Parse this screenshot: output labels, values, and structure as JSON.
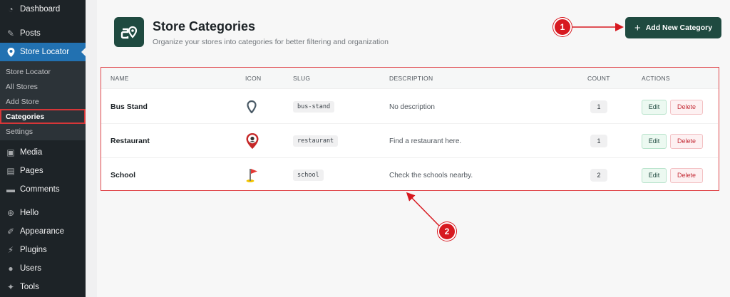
{
  "sidebar": {
    "top_items": [
      {
        "label": "Dashboard",
        "icon": "dashboard-icon"
      },
      {
        "label": "Posts",
        "icon": "pin-icon"
      },
      {
        "label": "Store Locator",
        "icon": "location-icon"
      }
    ],
    "submenu": [
      "Store Locator",
      "All Stores",
      "Add Store",
      "Categories",
      "Settings"
    ],
    "bottom_items": [
      {
        "label": "Media",
        "icon": "media-icon"
      },
      {
        "label": "Pages",
        "icon": "pages-icon"
      },
      {
        "label": "Comments",
        "icon": "comments-icon"
      },
      {
        "label": "Hello",
        "icon": "plus-circle-icon"
      },
      {
        "label": "Appearance",
        "icon": "brush-icon"
      },
      {
        "label": "Plugins",
        "icon": "plug-icon"
      },
      {
        "label": "Users",
        "icon": "user-icon"
      },
      {
        "label": "Tools",
        "icon": "wrench-icon"
      }
    ]
  },
  "header": {
    "title": "Store Categories",
    "subtitle": "Organize your stores into categories for better filtering and organization",
    "add_button": "Add New Category"
  },
  "table": {
    "columns": [
      "NAME",
      "ICON",
      "SLUG",
      "DESCRIPTION",
      "COUNT",
      "ACTIONS"
    ],
    "rows": [
      {
        "name": "Bus Stand",
        "icon": "map-pin-icon",
        "slug": "bus-stand",
        "description": "No description",
        "count": "1",
        "edit": "Edit",
        "delete": "Delete"
      },
      {
        "name": "Restaurant",
        "icon": "chef-pin-icon",
        "slug": "restaurant",
        "description": "Find a restaurant here.",
        "count": "1",
        "edit": "Edit",
        "delete": "Delete"
      },
      {
        "name": "School",
        "icon": "flag-icon",
        "slug": "school",
        "description": "Check the schools nearby.",
        "count": "2",
        "edit": "Edit",
        "delete": "Delete"
      }
    ]
  },
  "callouts": [
    "1",
    "2"
  ],
  "colors": {
    "accent": "#1f4a40",
    "wp_blue": "#2271b1",
    "callout_red": "#d71920"
  }
}
